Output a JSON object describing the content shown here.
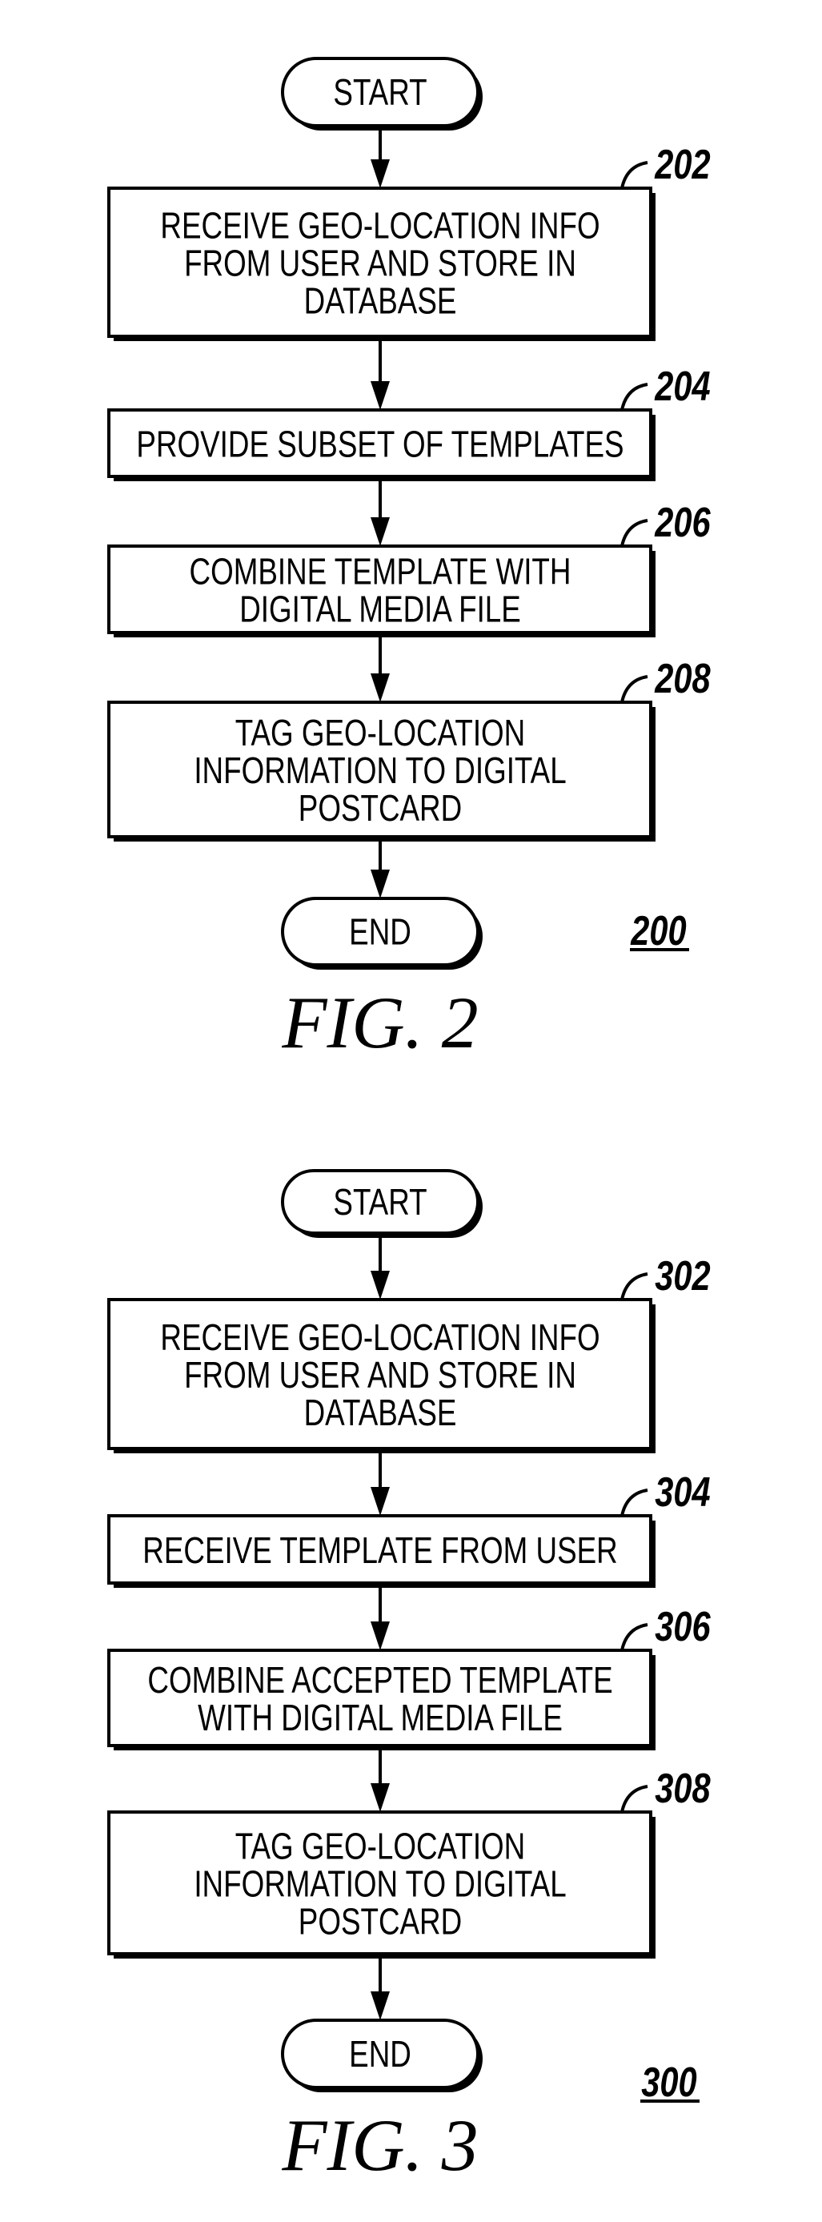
{
  "figures": [
    {
      "id": "fig2",
      "caption": "FIG. 2",
      "reference": "200",
      "start_label": "START",
      "end_label": "END",
      "steps": [
        {
          "ref": "202",
          "lines": [
            "RECEIVE GEO-LOCATION INFO",
            "FROM USER AND STORE IN",
            "DATABASE"
          ]
        },
        {
          "ref": "204",
          "lines": [
            "PROVIDE SUBSET OF TEMPLATES"
          ]
        },
        {
          "ref": "206",
          "lines": [
            "COMBINE TEMPLATE WITH",
            "DIGITAL MEDIA FILE"
          ]
        },
        {
          "ref": "208",
          "lines": [
            "TAG GEO-LOCATION",
            "INFORMATION TO DIGITAL",
            "POSTCARD"
          ]
        }
      ]
    },
    {
      "id": "fig3",
      "caption": "FIG. 3",
      "reference": "300",
      "start_label": "START",
      "end_label": "END",
      "steps": [
        {
          "ref": "302",
          "lines": [
            "RECEIVE GEO-LOCATION INFO",
            "FROM USER AND STORE IN",
            "DATABASE"
          ]
        },
        {
          "ref": "304",
          "lines": [
            "RECEIVE TEMPLATE FROM USER"
          ]
        },
        {
          "ref": "306",
          "lines": [
            "COMBINE ACCEPTED TEMPLATE",
            "WITH DIGITAL MEDIA FILE"
          ]
        },
        {
          "ref": "308",
          "lines": [
            "TAG GEO-LOCATION",
            "INFORMATION TO DIGITAL",
            "POSTCARD"
          ]
        }
      ]
    }
  ]
}
